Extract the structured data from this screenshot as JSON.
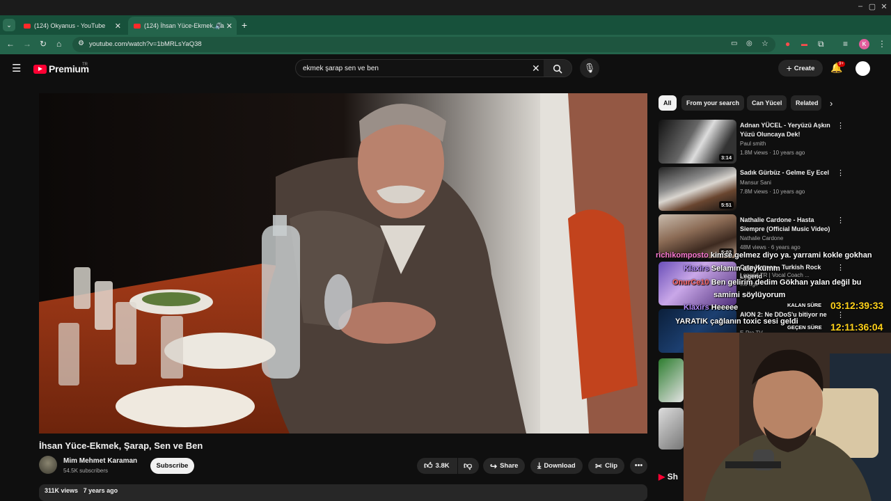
{
  "browser": {
    "tabs": [
      {
        "label": "(124) Okyanus - YouTube"
      },
      {
        "label": "(124) İhsan Yüce-Ekmek, Şa"
      }
    ],
    "url": "youtube.com/watch?v=1bMRLsYaQ38",
    "profile_initial": "K"
  },
  "youtube": {
    "logo_text": "Premium",
    "logo_region": "TR",
    "search_value": "ekmek şarap sen ve ben",
    "create_label": "Create",
    "notif_count": "9+"
  },
  "video": {
    "title": "İhsan Yüce-Ekmek, Şarap, Sen ve Ben",
    "channel": "Mim Mehmet Karaman",
    "subscribers": "54.5K subscribers",
    "subscribe_label": "Subscribe",
    "likes": "3.8K",
    "share_label": "Share",
    "download_label": "Download",
    "clip_label": "Clip",
    "views": "311K views",
    "age": "7 years ago"
  },
  "chips": [
    "All",
    "From your search",
    "Can Yücel",
    "Related"
  ],
  "recommendations": [
    {
      "title": "Adnan YÜCEL - Yeryüzü Aşkın Yüzü Oluncaya Dek!",
      "channel": "Paul smith",
      "meta": "1.8M views · 10 years ago",
      "duration": "3:14"
    },
    {
      "title": "Sadık Gürbüz - Gelme Ey Ecel",
      "channel": "Mansur Sani",
      "meta": "7.8M views · 10 years ago",
      "duration": "5:51"
    },
    {
      "title": "Nathalie Cardone - Hasta Siempre (Official Music Video)",
      "channel": "Nathalie Cardone",
      "meta": "48M views · 6 years ago",
      "duration": "5:02"
    },
    {
      "title": "Cem Karaca - Turkish Rock Legend",
      "channel": "Legend TR | Vocal Coach ...",
      "meta": "ths ago",
      "duration": ""
    },
    {
      "title": "AION 2: Ne DDoS'u bitiyor ne",
      "channel": "E-Pro TV",
      "meta": "",
      "duration": ""
    }
  ],
  "chat": [
    {
      "user": "richikomposto",
      "msg": "kimse gelmez diyo ya. yarrami kokle gokhan",
      "color": "#ff7bd5"
    },
    {
      "user": "Klaxirs",
      "msg": "Selamın aleykümm",
      "color": "#b58cff"
    },
    {
      "user": "OnurCe10",
      "msg": "Ben gelirim dedim Gökhan yalan değil bu",
      "color": "#ff6b6b"
    },
    {
      "user": "",
      "msg": "samimi söylüyorum",
      "color": "#ffffff"
    },
    {
      "user": "Klaxirs",
      "msg": "Heeeee",
      "color": "#b58cff"
    },
    {
      "user": "YARATIK",
      "msg": "çağlanın toxic sesi geldi",
      "color": "#ffffff"
    }
  ],
  "timers": {
    "remaining_label": "KALAN SÜRE",
    "remaining": "03:12:39:33",
    "elapsed_label": "GEÇEN SÜRE",
    "elapsed": "12:11:36:04"
  },
  "shorts_label": "Sh",
  "colors": {
    "accent": "#ff0033",
    "browser_bar": "#24644b",
    "timer": "#ffd21a"
  }
}
